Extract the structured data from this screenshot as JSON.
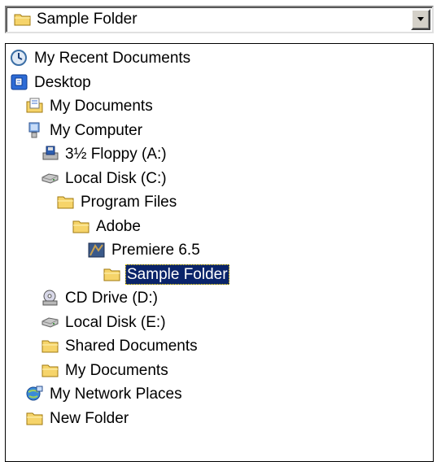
{
  "combo": {
    "selected_label": "Sample Folder",
    "selected_icon": "folder-icon"
  },
  "tree": [
    {
      "label": "My Recent Documents",
      "icon": "recent-documents-icon",
      "depth": 0,
      "selected": false
    },
    {
      "label": "Desktop",
      "icon": "desktop-icon",
      "depth": 0,
      "selected": false
    },
    {
      "label": "My Documents",
      "icon": "my-documents-icon",
      "depth": 1,
      "selected": false
    },
    {
      "label": "My Computer",
      "icon": "my-computer-icon",
      "depth": 1,
      "selected": false
    },
    {
      "label": "3½ Floppy (A:)",
      "icon": "floppy-drive-icon",
      "depth": 2,
      "selected": false
    },
    {
      "label": "Local Disk (C:)",
      "icon": "hard-disk-icon",
      "depth": 2,
      "selected": false
    },
    {
      "label": "Program Files",
      "icon": "folder-icon",
      "depth": 3,
      "selected": false
    },
    {
      "label": "Adobe",
      "icon": "folder-icon",
      "depth": 4,
      "selected": false
    },
    {
      "label": "Premiere 6.5",
      "icon": "premiere-app-icon",
      "depth": 5,
      "selected": false
    },
    {
      "label": "Sample Folder",
      "icon": "folder-icon",
      "depth": 6,
      "selected": true
    },
    {
      "label": "CD Drive (D:)",
      "icon": "cd-drive-icon",
      "depth": 2,
      "selected": false
    },
    {
      "label": "Local Disk (E:)",
      "icon": "hard-disk-icon",
      "depth": 2,
      "selected": false
    },
    {
      "label": "Shared Documents",
      "icon": "folder-icon",
      "depth": 2,
      "selected": false
    },
    {
      "label": "My Documents",
      "icon": "folder-icon",
      "depth": 2,
      "selected": false
    },
    {
      "label": "My Network Places",
      "icon": "network-places-icon",
      "depth": 1,
      "selected": false
    },
    {
      "label": "New Folder",
      "icon": "folder-icon",
      "depth": 1,
      "selected": false
    }
  ],
  "colors": {
    "selection_bg": "#0a246a",
    "selection_text": "#ffffff",
    "folder_yellow": "#f6d46a"
  }
}
